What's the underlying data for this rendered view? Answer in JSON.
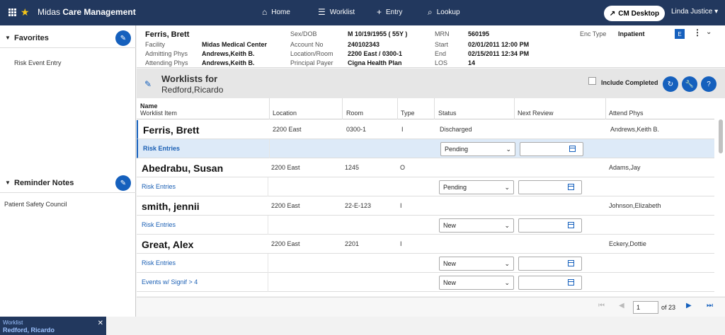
{
  "app": {
    "brand_prefix": "Midas",
    "brand_bold": "Care Management"
  },
  "nav": {
    "home": "Home",
    "worklist": "Worklist",
    "entry": "Entry",
    "lookup": "Lookup"
  },
  "header": {
    "cm_desktop": "CM Desktop",
    "user": "Linda Justice"
  },
  "left": {
    "favorites_title": "Favorites",
    "favorites_items": [
      "Risk Event Entry"
    ],
    "reminders_title": "Reminder Notes",
    "reminder_items": [
      "Patient Safety Council"
    ]
  },
  "patient": {
    "name": "Ferris, Brett",
    "facility_label": "Facility",
    "facility": "Midas Medical Center",
    "admitting_label": "Admitting Phys",
    "admitting": "Andrews,Keith B.",
    "attending_label": "Attending Phys",
    "attending": "Andrews,Keith B.",
    "sexdob_label": "Sex/DOB",
    "sexdob": "M  10/19/1955 ( 55Y )",
    "account_label": "Account No",
    "account": "240102343",
    "location_label": "Location/Room",
    "location": "2200 East / 0300-1",
    "payer_label": "Principal Payer",
    "payer": "Cigna Health Plan",
    "mrn_label": "MRN",
    "mrn": "560195",
    "start_label": "Start",
    "start": "02/01/2011 12:00 PM",
    "end_label": "End",
    "end": "02/15/2011 12:34 PM",
    "los_label": "LOS",
    "los": "14",
    "enctype_label": "Enc Type",
    "enctype": "Inpatient",
    "badge": "E"
  },
  "worklist": {
    "title": "Worklists for",
    "owner": "Redford,Ricardo",
    "include_completed": "Include Completed",
    "columns": {
      "name": "Name",
      "item": "Worklist Item",
      "location": "Location",
      "room": "Room",
      "type": "Type",
      "status": "Status",
      "next_review": "Next Review",
      "attend": "Attend Phys"
    },
    "rows": [
      {
        "name": "Ferris, Brett",
        "location": "2200 East",
        "room": "0300-1",
        "type": "I",
        "status_text": "Discharged",
        "attend": "Andrews,Keith B.",
        "items": [
          {
            "label": "Risk Entries",
            "status": "Pending"
          }
        ]
      },
      {
        "name": "Abedrabu, Susan",
        "location": "2200 East",
        "room": "1245",
        "type": "O",
        "status_text": "",
        "attend": "Adams,Jay",
        "items": [
          {
            "label": "Risk Entries",
            "status": "Pending"
          }
        ]
      },
      {
        "name": "smith, jennii",
        "location": "2200 East",
        "room": "22-E-123",
        "type": "I",
        "status_text": "",
        "attend": "Johnson,Elizabeth",
        "items": [
          {
            "label": "Risk Entries",
            "status": "New"
          }
        ]
      },
      {
        "name": "Great, Alex",
        "location": "2200 East",
        "room": "2201",
        "type": "I",
        "status_text": "",
        "attend": "Eckery,Dottie",
        "items": [
          {
            "label": "Risk Entries",
            "status": "New"
          },
          {
            "label": "Events w/ Signif > 4",
            "status": "New"
          }
        ]
      }
    ]
  },
  "pager": {
    "page": "1",
    "of": "of 23"
  },
  "bottom_tab": {
    "label": "Worklist",
    "name": "Redford, Ricardo"
  }
}
